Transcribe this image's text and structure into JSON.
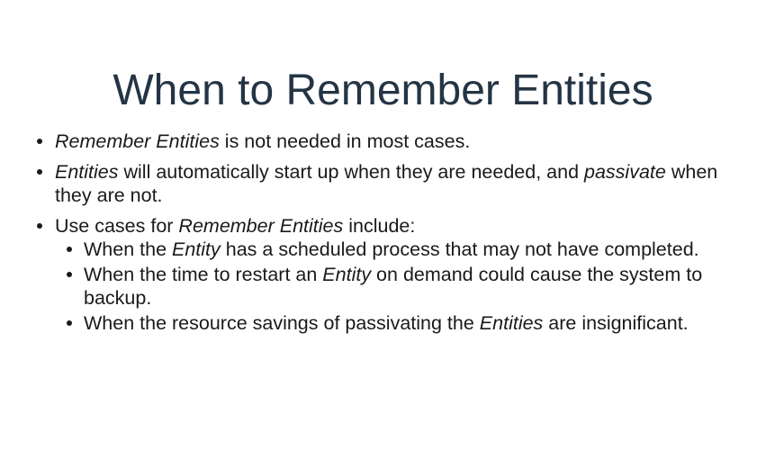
{
  "slide": {
    "title": "When to Remember Entities",
    "bullets": [
      {
        "parts": [
          {
            "text": "Remember Entities",
            "italic": true
          },
          {
            "text": " is not needed in most cases.",
            "italic": false
          }
        ]
      },
      {
        "parts": [
          {
            "text": "Entities",
            "italic": true
          },
          {
            "text": " will automatically start up when they are needed, and ",
            "italic": false
          },
          {
            "text": "passivate",
            "italic": true
          },
          {
            "text": " when they are not.",
            "italic": false
          }
        ]
      },
      {
        "parts": [
          {
            "text": "Use cases for ",
            "italic": false
          },
          {
            "text": "Remember Entities",
            "italic": true
          },
          {
            "text": " include:",
            "italic": false
          }
        ],
        "sub": [
          {
            "parts": [
              {
                "text": "When the ",
                "italic": false
              },
              {
                "text": "Entity",
                "italic": true
              },
              {
                "text": " has a scheduled process that may not have completed.",
                "italic": false
              }
            ]
          },
          {
            "parts": [
              {
                "text": "When the time to restart an ",
                "italic": false
              },
              {
                "text": "Entity",
                "italic": true
              },
              {
                "text": " on demand could cause the system to backup.",
                "italic": false
              }
            ]
          },
          {
            "parts": [
              {
                "text": "When the resource savings of passivating the ",
                "italic": false
              },
              {
                "text": "Entities",
                "italic": true
              },
              {
                "text": " are insignificant.",
                "italic": false
              }
            ]
          }
        ]
      }
    ]
  }
}
